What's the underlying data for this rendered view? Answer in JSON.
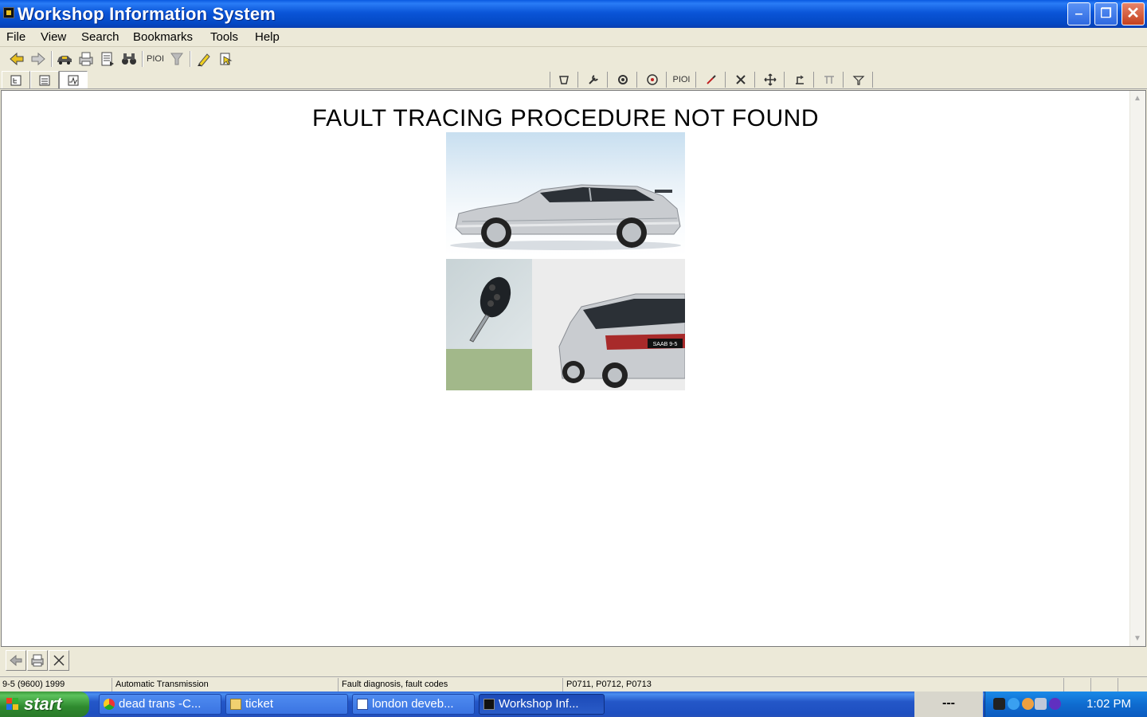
{
  "window": {
    "title": "Workshop Information System",
    "controls": {
      "minimize": "‒",
      "maximize": "❐",
      "close": "✕"
    }
  },
  "menu": [
    "File",
    "View",
    "Search",
    "Bookmarks",
    "Tools",
    "Help"
  ],
  "toolbar_icons": {
    "back": "back-arrow-icon",
    "forward": "forward-arrow-icon",
    "vehicle": "car-icon",
    "print": "printer-icon",
    "export": "document-icon",
    "find": "binoculars-icon",
    "pio_label": "PIOI",
    "filter": "filter-icon",
    "highlight": "highlighter-icon",
    "pointer": "pointer-icon"
  },
  "toolbar2": {
    "pio_label": "PIOI"
  },
  "content": {
    "heading": "FAULT TRACING PROCEDURE NOT FOUND",
    "car_badge": "SAAB 9-5"
  },
  "status": {
    "vehicle": "9-5 (9600) 1999",
    "system": "Automatic Transmission",
    "section": "Fault diagnosis, fault codes",
    "codes": "P0711, P0712, P0713"
  },
  "taskbar": {
    "start_label": "start",
    "tasks": [
      "dead trans -C...",
      "ticket",
      "london deveb...",
      "Workshop Inf..."
    ],
    "tray_dash": "---",
    "clock": "1:02 PM"
  },
  "colors": {
    "titlebar": "#0a55d8",
    "taskbar": "#2457c8",
    "start": "#3c9a3c",
    "chrome": "#ece9d8"
  }
}
